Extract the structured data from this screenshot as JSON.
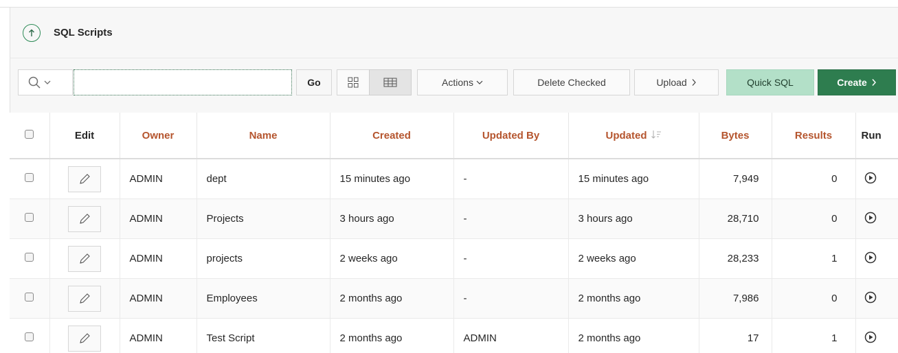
{
  "region": {
    "title": "SQL Scripts",
    "collapse_icon": "arrow-up-circle-icon"
  },
  "toolbar": {
    "search_value": "",
    "go_label": "Go",
    "actions_label": "Actions",
    "delete_label": "Delete Checked",
    "upload_label": "Upload",
    "quicksql_label": "Quick SQL",
    "create_label": "Create",
    "active_view": "report"
  },
  "table": {
    "headers": {
      "edit": "Edit",
      "owner": "Owner",
      "name": "Name",
      "created": "Created",
      "updated_by": "Updated By",
      "updated": "Updated",
      "bytes": "Bytes",
      "results": "Results",
      "run": "Run"
    },
    "sort_column": "updated",
    "sort_direction": "descending",
    "rows": [
      {
        "owner": "ADMIN",
        "name": "dept",
        "created": "15 minutes ago",
        "updated_by": "-",
        "updated": "15 minutes ago",
        "bytes": "7,949",
        "results": "0"
      },
      {
        "owner": "ADMIN",
        "name": "Projects",
        "created": "3 hours ago",
        "updated_by": "-",
        "updated": "3 hours ago",
        "bytes": "28,710",
        "results": "0"
      },
      {
        "owner": "ADMIN",
        "name": "projects",
        "created": "2 weeks ago",
        "updated_by": "-",
        "updated": "2 weeks ago",
        "bytes": "28,233",
        "results": "1"
      },
      {
        "owner": "ADMIN",
        "name": "Employees",
        "created": "2 months ago",
        "updated_by": "-",
        "updated": "2 months ago",
        "bytes": "7,986",
        "results": "0"
      },
      {
        "owner": "ADMIN",
        "name": "Test Script",
        "created": "2 months ago",
        "updated_by": "ADMIN",
        "updated": "2 months ago",
        "bytes": "17",
        "results": "1"
      }
    ]
  },
  "colors": {
    "accent_green": "#2e7d4f",
    "quick_sql_bg": "#b3e0c8",
    "header_link": "#b5552e"
  }
}
